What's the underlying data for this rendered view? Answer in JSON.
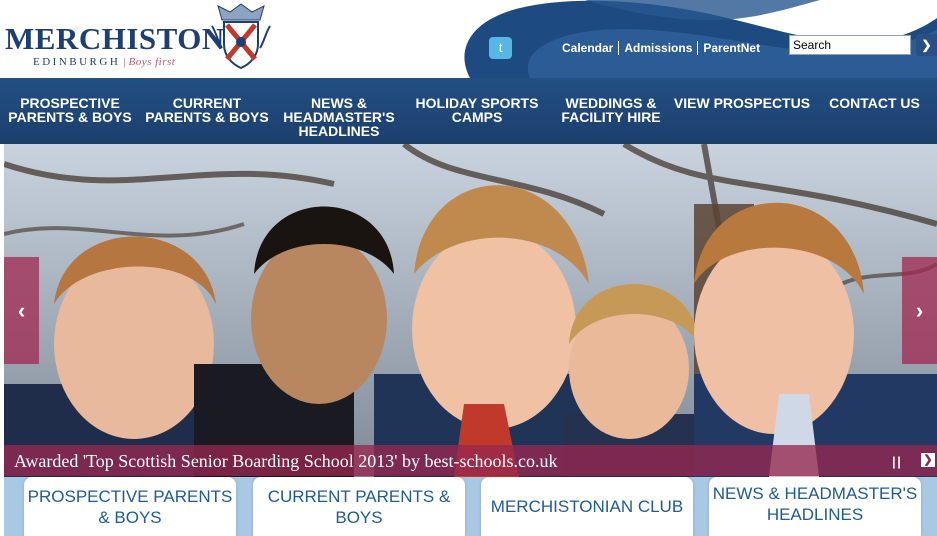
{
  "header": {
    "logo_title": "MERCHISTON",
    "logo_location": "EDINBURGH",
    "logo_tagline": "Boys first",
    "twitter_icon": "twitter-icon",
    "top_links": [
      "Calendar",
      "Admissions",
      "ParentNet"
    ],
    "search_placeholder": "Search",
    "search_value": "Search",
    "search_button_icon": "arrow-right-icon"
  },
  "nav": {
    "items": [
      "PROSPECTIVE PARENTS & BOYS",
      "CURRENT PARENTS & BOYS",
      "NEWS & HEADMASTER'S HEADLINES",
      "HOLIDAY SPORTS CAMPS",
      "WEDDINGS & FACILITY HIRE",
      "VIEW PROSPECTUS",
      "CONTACT US"
    ]
  },
  "hero": {
    "caption": "Awarded 'Top Scottish Senior Boarding School 2013' by best-schools.co.uk",
    "prev_icon": "chevron-left-icon",
    "next_icon": "chevron-right-icon",
    "pause_icon": "pause-icon",
    "close_icon": "close-icon"
  },
  "tiles": [
    "PROSPECTIVE PARENTS & BOYS",
    "CURRENT PARENTS & BOYS",
    "MERCHISTONIAN CLUB",
    "NEWS & HEADMASTER'S HEADLINES"
  ],
  "colors": {
    "brand_navy": "#1e3f73",
    "nav_blue": "#234f83",
    "accent_maroon": "#962850",
    "tile_text": "#1f5a9a",
    "tile_band": "#a8c8e4"
  }
}
